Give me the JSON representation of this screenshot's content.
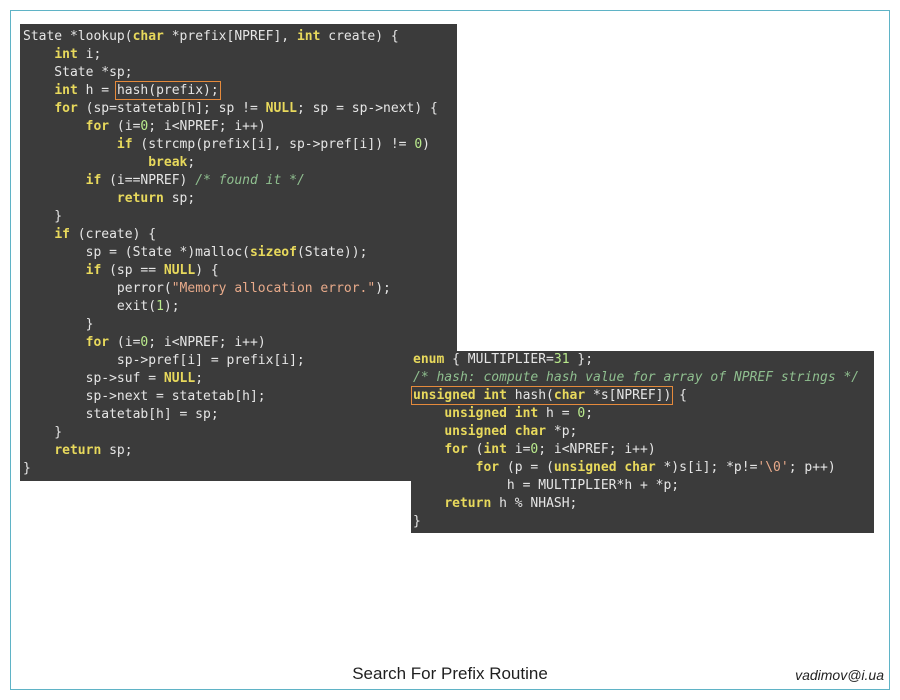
{
  "lookup_code": {
    "lines": [
      [
        [
          "State *lookup(",
          "pl"
        ],
        [
          "char",
          "kw"
        ],
        [
          " *prefix[NPREF], ",
          "pl"
        ],
        [
          "int",
          "kw"
        ],
        [
          " create) {",
          "pl"
        ]
      ],
      [
        [
          "    ",
          "pl"
        ],
        [
          "int",
          "kw"
        ],
        [
          " i;",
          "pl"
        ]
      ],
      [
        [
          "    State *sp;",
          "pl"
        ]
      ],
      [
        [
          "    ",
          "pl"
        ],
        [
          "int",
          "kw"
        ],
        [
          " h = ",
          "pl"
        ],
        [
          "hash(prefix);",
          "pl",
          true
        ]
      ],
      [
        [
          "    ",
          "pl"
        ],
        [
          "for",
          "kw"
        ],
        [
          " (sp=statetab[h]; sp != ",
          "pl"
        ],
        [
          "NULL",
          "kw"
        ],
        [
          "; sp = sp->next) {",
          "pl"
        ]
      ],
      [
        [
          "        ",
          "pl"
        ],
        [
          "for",
          "kw"
        ],
        [
          " (i=",
          "pl"
        ],
        [
          "0",
          "nu"
        ],
        [
          "; i<NPREF; i++)",
          "pl"
        ]
      ],
      [
        [
          "            ",
          "pl"
        ],
        [
          "if",
          "kw"
        ],
        [
          " (strcmp(prefix[i], sp->pref[i]) != ",
          "pl"
        ],
        [
          "0",
          "nu"
        ],
        [
          ")",
          "pl"
        ]
      ],
      [
        [
          "                ",
          "pl"
        ],
        [
          "break",
          "kw"
        ],
        [
          ";",
          "pl"
        ]
      ],
      [
        [
          "        ",
          "pl"
        ],
        [
          "if",
          "kw"
        ],
        [
          " (i==NPREF) ",
          "pl"
        ],
        [
          "/* found it */",
          "cm"
        ]
      ],
      [
        [
          "            ",
          "pl"
        ],
        [
          "return",
          "kw"
        ],
        [
          " sp;",
          "pl"
        ]
      ],
      [
        [
          "    }",
          "pl"
        ]
      ],
      [
        [
          "    ",
          "pl"
        ],
        [
          "if",
          "kw"
        ],
        [
          " (create) {",
          "pl"
        ]
      ],
      [
        [
          "        sp = (State *)malloc(",
          "pl"
        ],
        [
          "sizeof",
          "kw"
        ],
        [
          "(State));",
          "pl"
        ]
      ],
      [
        [
          "        ",
          "pl"
        ],
        [
          "if",
          "kw"
        ],
        [
          " (sp == ",
          "pl"
        ],
        [
          "NULL",
          "kw"
        ],
        [
          ") {",
          "pl"
        ]
      ],
      [
        [
          "            perror(",
          "pl"
        ],
        [
          "\"Memory allocation error.\"",
          "st"
        ],
        [
          ");",
          "pl"
        ]
      ],
      [
        [
          "            exit(",
          "pl"
        ],
        [
          "1",
          "nu"
        ],
        [
          ");",
          "pl"
        ]
      ],
      [
        [
          "        }",
          "pl"
        ]
      ],
      [
        [
          "        ",
          "pl"
        ],
        [
          "for",
          "kw"
        ],
        [
          " (i=",
          "pl"
        ],
        [
          "0",
          "nu"
        ],
        [
          "; i<NPREF; i++)",
          "pl"
        ]
      ],
      [
        [
          "            sp->pref[i] = prefix[i];",
          "pl"
        ]
      ],
      [
        [
          "        sp->suf = ",
          "pl"
        ],
        [
          "NULL",
          "kw"
        ],
        [
          ";",
          "pl"
        ]
      ],
      [
        [
          "        sp->next = statetab[h];",
          "pl"
        ]
      ],
      [
        [
          "        statetab[h] = sp;",
          "pl"
        ]
      ],
      [
        [
          "    }",
          "pl"
        ]
      ],
      [
        [
          "    ",
          "pl"
        ],
        [
          "return",
          "kw"
        ],
        [
          " sp;",
          "pl"
        ]
      ],
      [
        [
          "}",
          "pl"
        ]
      ]
    ]
  },
  "hash_code": {
    "lines": [
      [
        [
          "enum",
          "kw"
        ],
        [
          " { MULTIPLIER=",
          "pl"
        ],
        [
          "31",
          "nu"
        ],
        [
          " };",
          "pl"
        ]
      ],
      [
        [
          "/* hash: compute hash value for array of NPREF strings */",
          "cm"
        ]
      ],
      [
        [
          "unsigned int",
          "kw",
          true
        ],
        [
          " hash(",
          "pl",
          true
        ],
        [
          "char",
          "kw",
          true
        ],
        [
          " *s[NPREF])",
          "pl",
          true
        ],
        [
          " {",
          "pl"
        ]
      ],
      [
        [
          "    ",
          "pl"
        ],
        [
          "unsigned int",
          "kw"
        ],
        [
          " h = ",
          "pl"
        ],
        [
          "0",
          "nu"
        ],
        [
          ";",
          "pl"
        ]
      ],
      [
        [
          "    ",
          "pl"
        ],
        [
          "unsigned char",
          "kw"
        ],
        [
          " *p;",
          "pl"
        ]
      ],
      [
        [
          "    ",
          "pl"
        ],
        [
          "for",
          "kw"
        ],
        [
          " (",
          "pl"
        ],
        [
          "int",
          "kw"
        ],
        [
          " i=",
          "pl"
        ],
        [
          "0",
          "nu"
        ],
        [
          "; i<NPREF; i++)",
          "pl"
        ]
      ],
      [
        [
          "        ",
          "pl"
        ],
        [
          "for",
          "kw"
        ],
        [
          " (p = (",
          "pl"
        ],
        [
          "unsigned char",
          "kw"
        ],
        [
          " *)s[i]; *p!=",
          "pl"
        ],
        [
          "'\\0'",
          "st"
        ],
        [
          "; p++)",
          "pl"
        ]
      ],
      [
        [
          "            h = MULTIPLIER*h + *p;",
          "pl"
        ]
      ],
      [
        [
          "    ",
          "pl"
        ],
        [
          "return",
          "kw"
        ],
        [
          " h % NHASH;",
          "pl"
        ]
      ],
      [
        [
          "}",
          "pl"
        ]
      ]
    ]
  },
  "caption": "Search For Prefix Routine",
  "signature": "vadimov@i.ua",
  "colors": {
    "background": "#3b3b3b",
    "keyword": "#e8d95c",
    "string": "#e8aa8a",
    "number": "#b9ea8c",
    "comment": "#8fbf8f",
    "highlight_box": "#e58a3c",
    "frame": "#5fb3c6"
  }
}
